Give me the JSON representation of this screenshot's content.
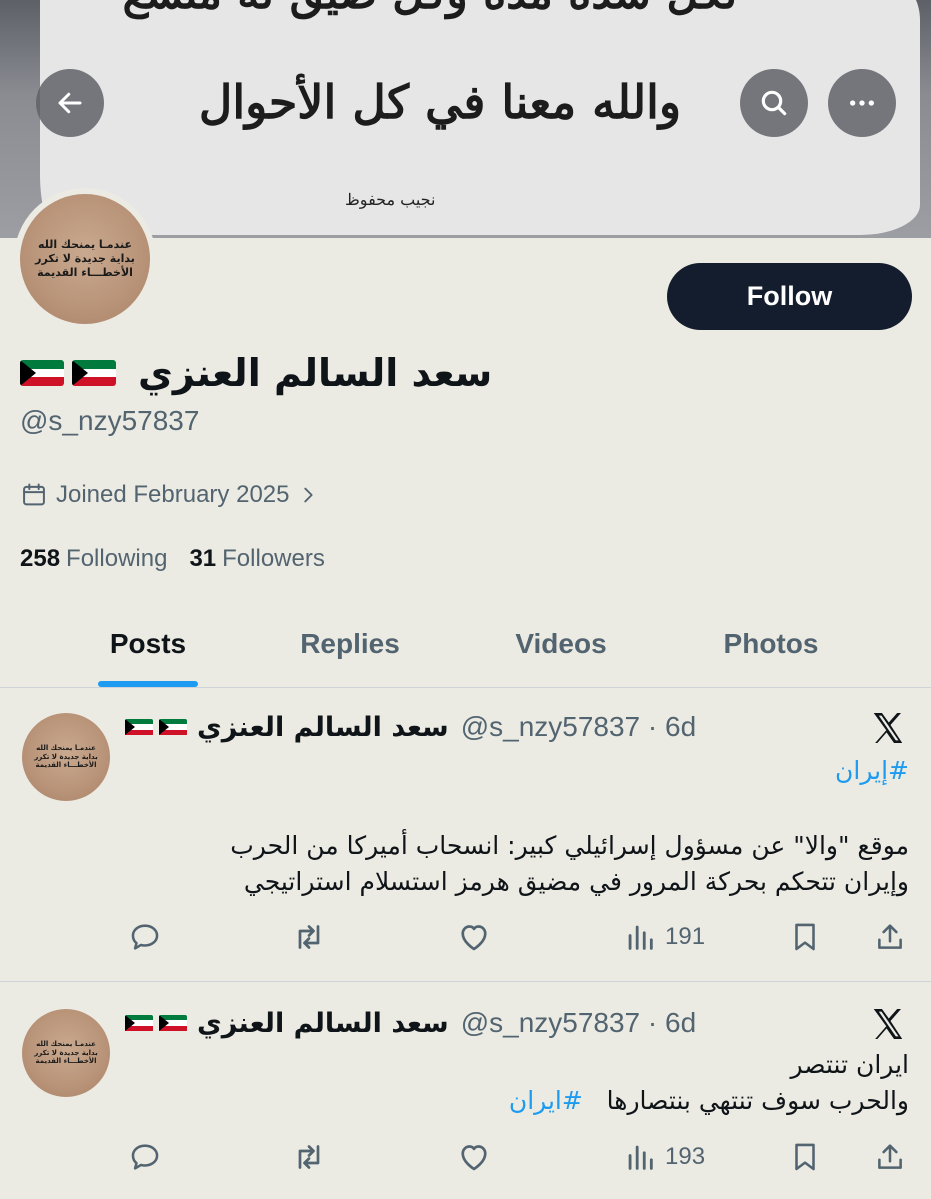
{
  "banner": {
    "line1": "لكل شدة مدة وكل ضيق له متسع",
    "line2": "والله معنا في كل الأحوال",
    "signature": "نجيب محفوظ"
  },
  "avatar_text": [
    "عندمـا يمنحك الله",
    "بداية جديدة لا تكرر",
    "الأخطـــاء القديمة"
  ],
  "profile": {
    "name": "سعد السالم العنزي",
    "handle": "@s_nzy57837",
    "joined": "Joined February 2025",
    "following_count": "258",
    "following_label": "Following",
    "followers_count": "31",
    "followers_label": "Followers",
    "follow_label": "Follow"
  },
  "tabs": [
    {
      "label": "Posts",
      "active": true
    },
    {
      "label": "Replies",
      "active": false
    },
    {
      "label": "Videos",
      "active": false
    },
    {
      "label": "Photos",
      "active": false
    }
  ],
  "posts": [
    {
      "name": "سعد السالم العنزي",
      "meta": "@s_nzy57837 · 6d",
      "hashtag": "#إيران",
      "text_line1": "موقع \"والا\" عن مسؤول إسرائيلي كبير: انسحاب أميركا من الحرب",
      "text_line2": "وإيران تتحكم بحركة المرور في مضيق هرمز استسلام استراتيجي",
      "views": "191"
    },
    {
      "name": "سعد السالم العنزي",
      "meta": "@s_nzy57837 · 6d",
      "text_line1": "ايران تنتصر",
      "text_line2": "والحرب سوف تنتهي بنتصارها",
      "hashtag": "#ايران",
      "views": "193"
    }
  ],
  "colors": {
    "background": "#ecebe3",
    "accent": "#1d9bf0",
    "follow_button": "#141d2e",
    "secondary_text": "#536471"
  },
  "icons": [
    "back-arrow-icon",
    "search-icon",
    "more-icon",
    "calendar-icon",
    "chevron-right-icon",
    "kuwait-flag-icon",
    "x-logo-icon",
    "reply-icon",
    "repost-icon",
    "like-icon",
    "views-icon",
    "bookmark-icon",
    "share-icon"
  ]
}
